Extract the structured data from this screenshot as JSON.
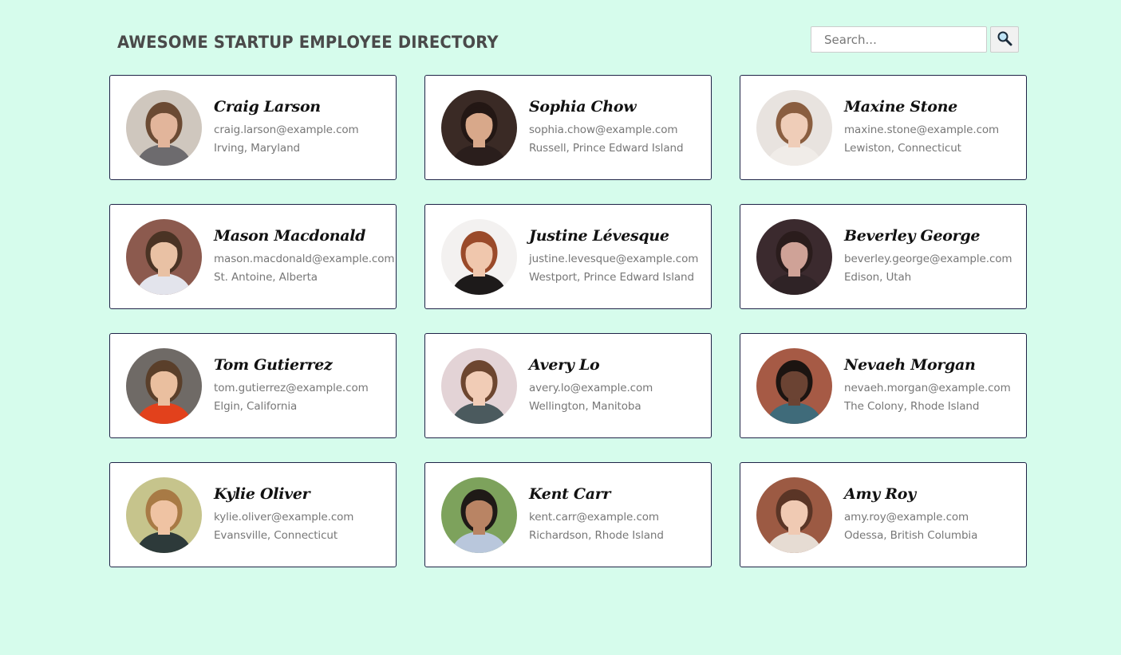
{
  "header": {
    "title": "AWESOME STARTUP EMPLOYEE DIRECTORY",
    "search_placeholder": "Search...",
    "search_icon": "magnifier-icon"
  },
  "employees": [
    {
      "name": "Craig Larson",
      "email": "craig.larson@example.com",
      "location": "Irving, Maryland",
      "bg": "#cfc7be",
      "skin": "#e2b59b",
      "hair": "#6b4a33",
      "shirt": "#6d6b6e"
    },
    {
      "name": "Sophia Chow",
      "email": "sophia.chow@example.com",
      "location": "Russell, Prince Edward Island",
      "bg": "#3a2a25",
      "skin": "#d8a88a",
      "hair": "#231714",
      "shirt": "#2a1e1c"
    },
    {
      "name": "Maxine Stone",
      "email": "maxine.stone@example.com",
      "location": "Lewiston, Connecticut",
      "bg": "#e8e3df",
      "skin": "#efcdb8",
      "hair": "#8a5e40",
      "shirt": "#f0ece8"
    },
    {
      "name": "Mason Macdonald",
      "email": "mason.macdonald@example.com",
      "location": "St. Antoine, Alberta",
      "bg": "#8c5a4e",
      "skin": "#e9c1a4",
      "hair": "#4a3324",
      "shirt": "#e3e4ec"
    },
    {
      "name": "Justine Lévesque",
      "email": "justine.levesque@example.com",
      "location": "Westport, Prince Edward Island",
      "bg": "#f3f1f0",
      "skin": "#f0c7ad",
      "hair": "#9a4a2a",
      "shirt": "#1d1a1a"
    },
    {
      "name": "Beverley George",
      "email": "beverley.george@example.com",
      "location": "Edison, Utah",
      "bg": "#3b2a2e",
      "skin": "#cfa297",
      "hair": "#2a1c1c",
      "shirt": "#2f2326"
    },
    {
      "name": "Tom Gutierrez",
      "email": "tom.gutierrez@example.com",
      "location": "Elgin, California",
      "bg": "#6f6a66",
      "skin": "#eabf9f",
      "hair": "#5a3f2a",
      "shirt": "#e2411c"
    },
    {
      "name": "Avery Lo",
      "email": "avery.lo@example.com",
      "location": "Wellington, Manitoba",
      "bg": "#e3d3d6",
      "skin": "#f1ccb6",
      "hair": "#6d4630",
      "shirt": "#4b5a5e"
    },
    {
      "name": "Nevaeh Morgan",
      "email": "nevaeh.morgan@example.com",
      "location": "The Colony, Rhode Island",
      "bg": "#a65a45",
      "skin": "#6b4333",
      "hair": "#1c1411",
      "shirt": "#3f6b7a"
    },
    {
      "name": "Kylie Oliver",
      "email": "kylie.oliver@example.com",
      "location": "Evansville, Connecticut",
      "bg": "#c6c48c",
      "skin": "#efc3a3",
      "hair": "#a87a45",
      "shirt": "#2d3a3a"
    },
    {
      "name": "Kent Carr",
      "email": "kent.carr@example.com",
      "location": "Richardson, Rhode Island",
      "bg": "#7da25c",
      "skin": "#b98464",
      "hair": "#1f1a17",
      "shirt": "#b9c7dc"
    },
    {
      "name": "Amy Roy",
      "email": "amy.roy@example.com",
      "location": "Odessa, British Columbia",
      "bg": "#9c5a43",
      "skin": "#f0cab3",
      "hair": "#5a3526",
      "shirt": "#e6dcd3"
    }
  ]
}
